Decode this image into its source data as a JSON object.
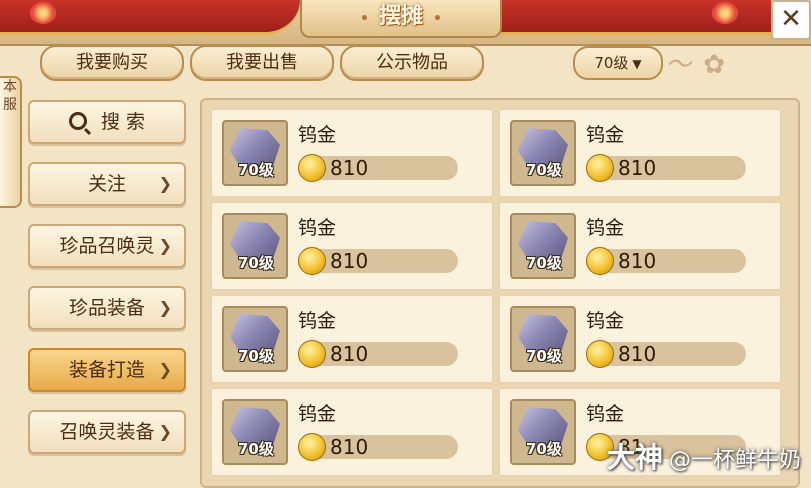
{
  "title": "摆摊",
  "close_label": "✕",
  "tabs": [
    "我要购买",
    "我要出售",
    "公示物品"
  ],
  "level_filter": {
    "selected": "70级"
  },
  "side_tab": "本服",
  "menu": [
    {
      "label": "搜 索",
      "icon": "search-icon",
      "arrow": false
    },
    {
      "label": "关注",
      "arrow": true
    },
    {
      "label": "珍品召唤灵",
      "arrow": true
    },
    {
      "label": "珍品装备",
      "arrow": true
    },
    {
      "label": "装备打造",
      "arrow": true,
      "active": true
    },
    {
      "label": "召唤灵装备",
      "arrow": true
    }
  ],
  "items": [
    {
      "name": "钨金",
      "level": "70级",
      "price": "810"
    },
    {
      "name": "钨金",
      "level": "70级",
      "price": "810"
    },
    {
      "name": "钨金",
      "level": "70级",
      "price": "810"
    },
    {
      "name": "钨金",
      "level": "70级",
      "price": "810"
    },
    {
      "name": "钨金",
      "level": "70级",
      "price": "810"
    },
    {
      "name": "钨金",
      "level": "70级",
      "price": "810"
    },
    {
      "name": "钨金",
      "level": "70级",
      "price": "810"
    },
    {
      "name": "钨金",
      "level": "70级",
      "price": "81"
    }
  ],
  "watermark": {
    "brand": "大神",
    "text": "@一杯鲜牛奶"
  },
  "colors": {
    "accent": "#e8aa48",
    "curtain": "#c9332a",
    "panel": "#ead6b2"
  }
}
